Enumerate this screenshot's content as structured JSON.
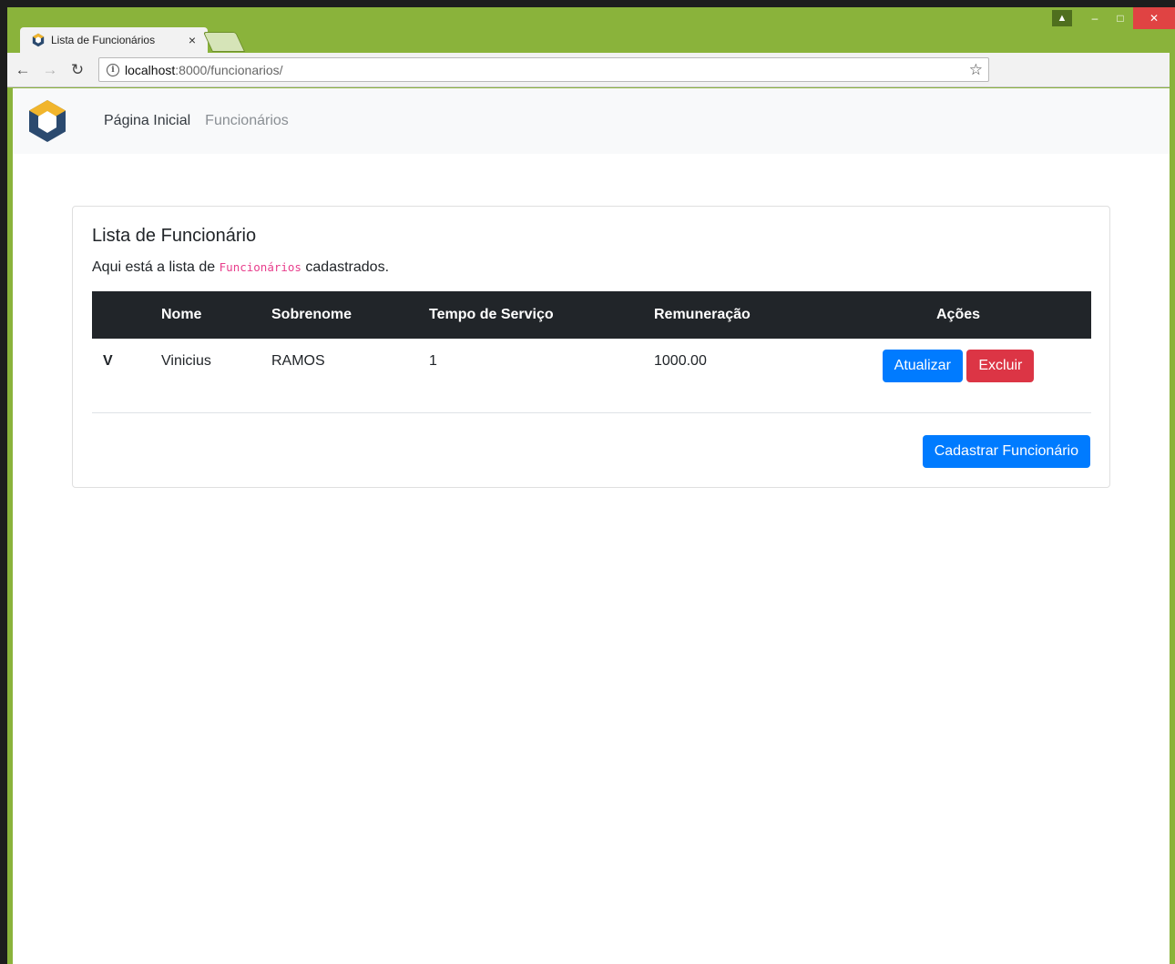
{
  "browser": {
    "tab_title": "Lista de Funcionários",
    "tab_close": "×",
    "url_host": "localhost",
    "url_path": ":8000/funcionarios/"
  },
  "nav": {
    "home": "Página Inicial",
    "employees": "Funcionários"
  },
  "card": {
    "title": "Lista de Funcionário",
    "text_before": "Aqui está a lista de ",
    "text_code": "Funcionários",
    "text_after": " cadastrados."
  },
  "table": {
    "headers": [
      "",
      "Nome",
      "Sobrenome",
      "Tempo de Serviço",
      "Remuneração",
      "Ações"
    ],
    "rows": [
      {
        "id": "V",
        "nome": "Vinicius",
        "sobrenome": "RAMOS",
        "tempo": "1",
        "remuneracao": "1000.00"
      }
    ],
    "update_label": "Atualizar",
    "delete_label": "Excluir"
  },
  "register_label": "Cadastrar Funcionário",
  "colors": {
    "primary": "#007bff",
    "danger": "#dc3545",
    "table_head": "#212529",
    "browser_frame": "#8ab33b"
  }
}
